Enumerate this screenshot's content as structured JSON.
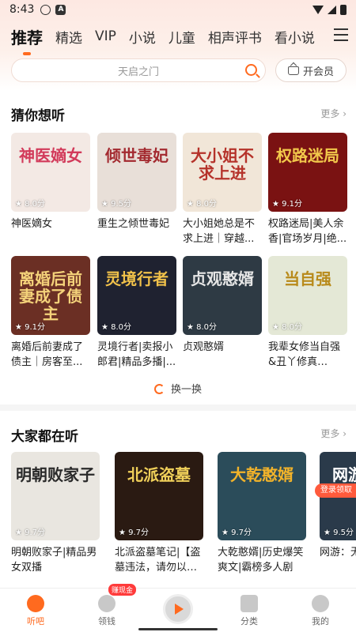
{
  "status": {
    "time": "8:43"
  },
  "top_tabs": [
    "推荐",
    "精选",
    "VIP",
    "小说",
    "儿童",
    "相声评书",
    "看小说"
  ],
  "search": {
    "placeholder": "天启之门",
    "vip_label": "开会员"
  },
  "guess": {
    "title": "猜你想听",
    "more": "更多 ›",
    "books": [
      {
        "cover_text": "神医嫡女",
        "rating": "★ 8.0分",
        "title": "神医嫡女",
        "bg": "#f3e9e4",
        "fg": "#d23a5a"
      },
      {
        "cover_text": "倾世毒妃",
        "rating": "★ 9.5分",
        "title": "重生之倾世毒妃",
        "bg": "#e8dfd8",
        "fg": "#a32a30"
      },
      {
        "cover_text": "大小姐不求上进",
        "rating": "★ 8.0分",
        "title": "大小姐她总是不求上进｜穿越...",
        "bg": "#f1e6d8",
        "fg": "#b5322a"
      },
      {
        "cover_text": "权路迷局",
        "rating": "★ 9.1分",
        "title": "权路迷局|美人余香|官场岁月|绝...",
        "bg": "#7a1212",
        "fg": "#f2c84b"
      },
      {
        "cover_text": "离婚后前妻成了债主",
        "rating": "★ 9.1分",
        "title": "离婚后前妻成了债主｜房客至...",
        "bg": "#6b2f24",
        "fg": "#f4d27a"
      },
      {
        "cover_text": "灵境行者",
        "rating": "★ 8.0分",
        "title": "灵境行者|卖报小郎君|精品多播|...",
        "bg": "#1f2230",
        "fg": "#f0c14a"
      },
      {
        "cover_text": "贞观憨婿",
        "rating": "★ 8.0分",
        "title": "贞观憨婿",
        "bg": "#2e3a44",
        "fg": "#e6e6e6"
      },
      {
        "cover_text": "当自强",
        "rating": "★ 8.0分",
        "title": "我辈女修当自强&丑丫修真记、...",
        "bg": "#e4e8d6",
        "fg": "#b88a1a"
      }
    ],
    "refresh": "换一换"
  },
  "popular": {
    "title": "大家都在听",
    "more": "更多 ›",
    "books": [
      {
        "cover_text": "明朝败家子",
        "rating": "★ 9.7分",
        "title": "明朝败家子|精品男女双播",
        "bg": "#e9e6e0",
        "fg": "#2a2a2a"
      },
      {
        "cover_text": "北派盗墓",
        "rating": "★ 9.7分",
        "title": "北派盗墓笔记|【盗墓违法，请勿以身...",
        "bg": "#2a1a12",
        "fg": "#f0d05a"
      },
      {
        "cover_text": "大乾憨婿",
        "rating": "★ 9.7分",
        "title": "大乾憨婿|历史爆笑爽文|霸榜多人剧",
        "bg": "#2b4c5a",
        "fg": "#f2b32a"
      },
      {
        "cover_text": "网游神级",
        "rating": "★ 9.5分",
        "title": "网游：无级天赋|...",
        "bg": "#2a3a4a",
        "fg": "#ffffff"
      }
    ],
    "login_badge": "登录领取"
  },
  "bottom_nav": {
    "items": [
      "听吧",
      "领钱",
      "",
      "分类",
      "我的"
    ],
    "cash_badge": "赚现金"
  },
  "colors": {
    "accent": "#ff6a1f"
  }
}
